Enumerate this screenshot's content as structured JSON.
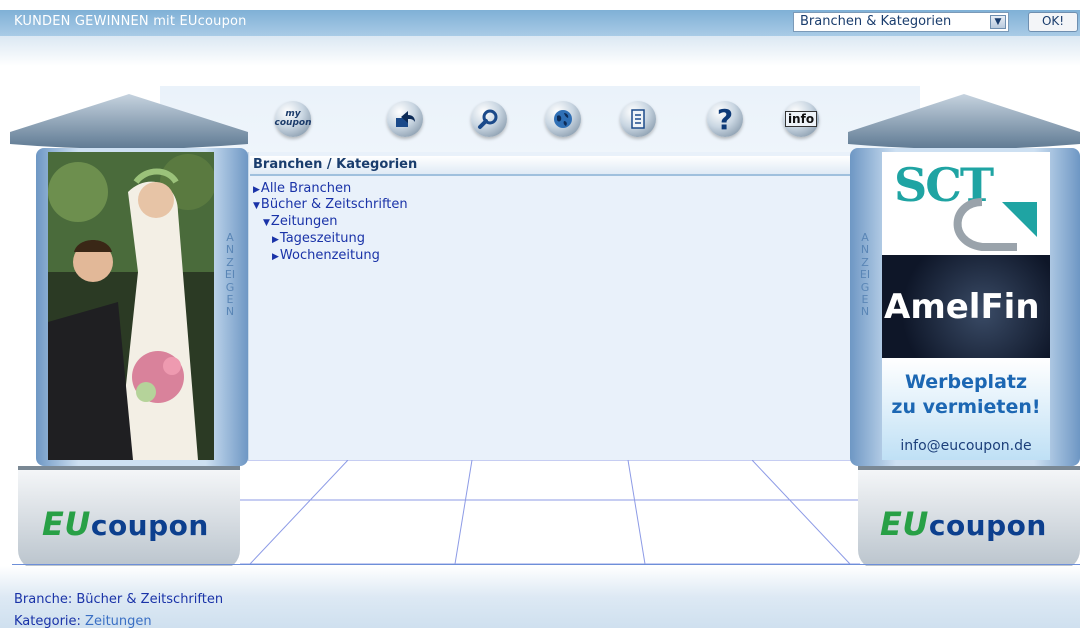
{
  "header": {
    "title": "KUNDEN GEWINNEN mit EUcoupon",
    "select_value": "Branchen & Kategorien",
    "ok_label": "OK!"
  },
  "toolbar": {
    "items": [
      {
        "name": "mycoupon",
        "icon": "mycoupon-icon",
        "label": "my coupon"
      },
      {
        "name": "back",
        "icon": "back-folder-icon"
      },
      {
        "name": "search",
        "icon": "magnifier-icon"
      },
      {
        "name": "world",
        "icon": "globe-icon"
      },
      {
        "name": "list",
        "icon": "list-page-icon"
      },
      {
        "name": "help",
        "icon": "question-icon",
        "label": "?"
      },
      {
        "name": "info",
        "icon": "info-sign-icon",
        "label": "info"
      }
    ]
  },
  "panel": {
    "heading": "Branchen / Kategorien",
    "tree": [
      {
        "label": "Alle Branchen",
        "marker": "▶"
      },
      {
        "label": "Bücher & Zeitschriften",
        "marker": "▼"
      },
      {
        "label": "Zeitungen",
        "marker": "▼"
      },
      {
        "label": "Tageszeitung",
        "marker": "▶"
      },
      {
        "label": "Wochenzeitung",
        "marker": "▶"
      }
    ]
  },
  "side_label": "ANZEIGEN",
  "logo": {
    "eu": "EU",
    "rest": "coupon"
  },
  "ads": {
    "sct": "SCT",
    "amelfin": "AmelFin",
    "free_line1": "Werbeplatz",
    "free_line2": "zu vermieten!",
    "free_email": "info@eucoupon.de"
  },
  "footer": {
    "branche_label": "Branche:",
    "branche_value": "Bücher & Zeitschriften",
    "kategorie_label": "Kategorie:",
    "kategorie_value": "Zeitungen"
  },
  "colors": {
    "link": "#1a33a8",
    "header_bar": "#7fb0d6",
    "logo_green": "#28a046",
    "logo_blue": "#0c3f8e"
  }
}
